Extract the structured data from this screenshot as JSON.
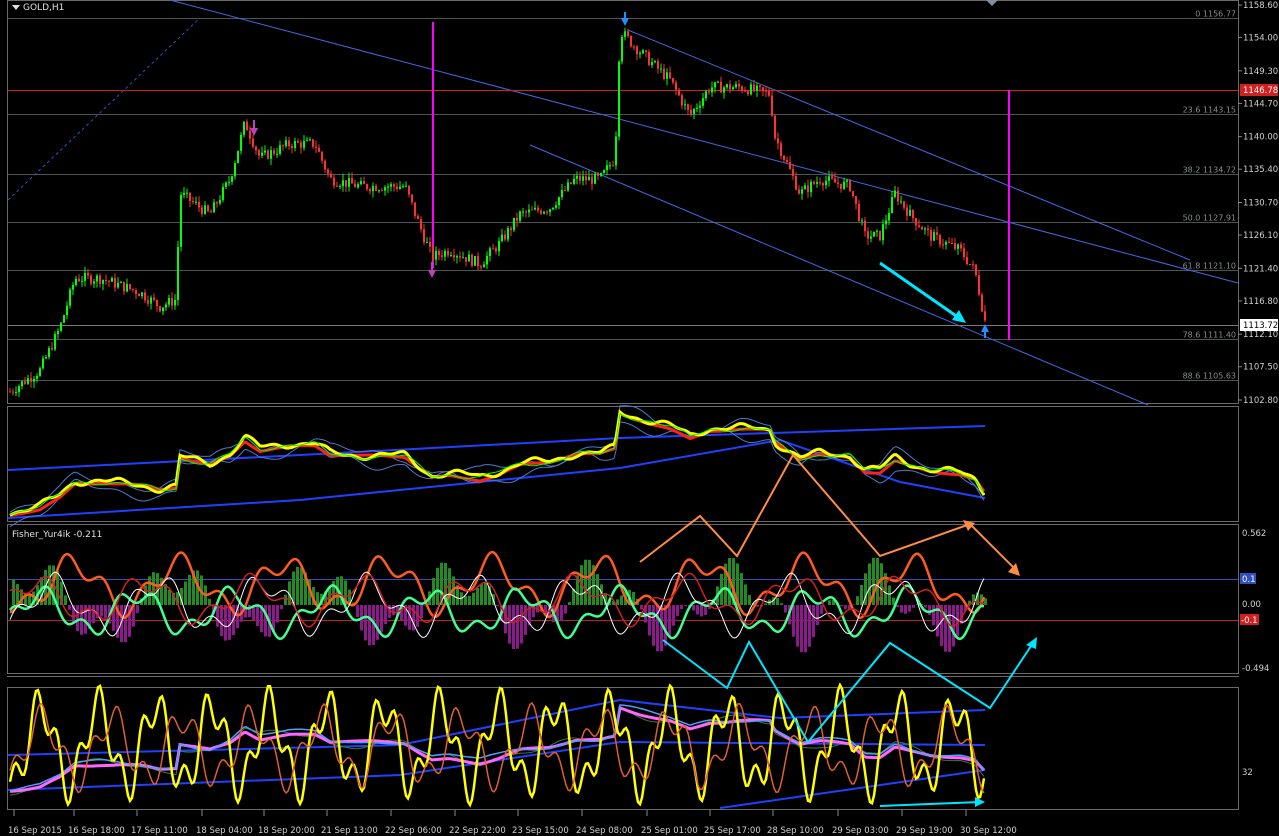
{
  "main_pane": {
    "symbol_title": "GOLD,H1",
    "price_axis": [
      "1158.60",
      "1154.00",
      "1149.30",
      "1144.70",
      "1140.00",
      "1135.40",
      "1130.70",
      "1126.10",
      "1121.40",
      "1116.80",
      "1112.10",
      "1107.50",
      "1102.80"
    ],
    "fib_levels": [
      {
        "label": "0 1156.77",
        "price": 1156.77
      },
      {
        "label": "23.6 1143.15",
        "price": 1143.15
      },
      {
        "label": "38.2 1134.72",
        "price": 1134.72
      },
      {
        "label": "50.0 1127.91",
        "price": 1127.91
      },
      {
        "label": "61.8 1121.10",
        "price": 1121.1
      },
      {
        "label": "78.6 1111.40",
        "price": 1111.4
      },
      {
        "label": "88.6 1105.63",
        "price": 1105.63
      }
    ],
    "red_level": {
      "label": "1146.78",
      "price": 1146.78
    },
    "current_price": {
      "label": "1113.72",
      "price": 1113.72
    }
  },
  "osc1_pane": {},
  "fisher_pane": {
    "title": "Fisher_Yur4ik -0.211",
    "axis": [
      "0.562",
      "0.00",
      "-0.494"
    ],
    "level_up": "0.1",
    "level_down": "-0.1"
  },
  "osc3_pane": {
    "axis": [
      "32"
    ]
  },
  "time_axis": [
    "16 Sep 2015",
    "16 Sep 18:00",
    "17 Sep 11:00",
    "18 Sep 04:00",
    "18 Sep 20:00",
    "21 Sep 13:00",
    "22 Sep 06:00",
    "22 Sep 22:00",
    "23 Sep 15:00",
    "24 Sep 08:00",
    "25 Sep 01:00",
    "25 Sep 17:00",
    "28 Sep 10:00",
    "29 Sep 03:00",
    "29 Sep 19:00",
    "30 Sep 12:00"
  ],
  "colors": {
    "background": "#000000",
    "grid": "#3a4a4a",
    "bull": "#00ff00",
    "bear": "#ff3030",
    "channel": "#4169e1",
    "magenta": "#ff00ff",
    "cyan": "#00e5ff",
    "orange": "#ff8c42",
    "yellow": "#ffff00",
    "red": "#ff2020",
    "blue": "#1030ff",
    "pink": "#ff66ff",
    "histo_green": "#228b22",
    "histo_purple": "#8b1a8b"
  }
}
